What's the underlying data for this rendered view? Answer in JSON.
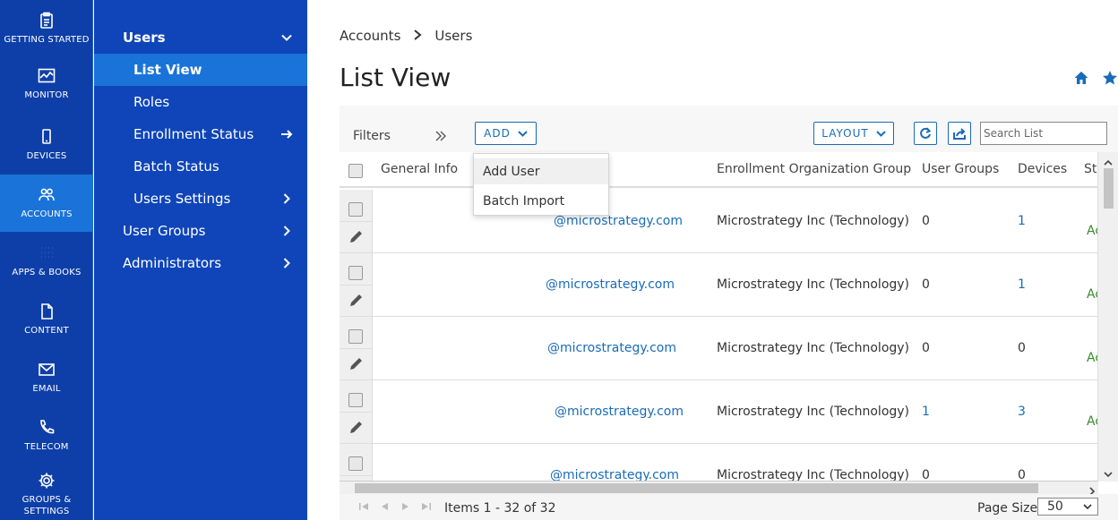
{
  "rail": {
    "items": [
      {
        "label": "GETTING STARTED",
        "icon": "clipboard-icon"
      },
      {
        "label": "MONITOR",
        "icon": "monitor-chart-icon"
      },
      {
        "label": "DEVICES",
        "icon": "phone-icon"
      },
      {
        "label": "ACCOUNTS",
        "icon": "users-icon"
      },
      {
        "label": "APPS & BOOKS",
        "icon": "grid-dots-icon"
      },
      {
        "label": "CONTENT",
        "icon": "document-icon"
      },
      {
        "label": "EMAIL",
        "icon": "envelope-icon"
      },
      {
        "label": "TELECOM",
        "icon": "telephone-icon"
      },
      {
        "label": "GROUPS & SETTINGS",
        "icon": "gear-icon"
      }
    ],
    "active": "ACCOUNTS"
  },
  "subnav": {
    "users": "Users",
    "list_view": "List View",
    "roles": "Roles",
    "enrollment_status": "Enrollment Status",
    "batch_status": "Batch Status",
    "users_settings": "Users Settings",
    "user_groups": "User Groups",
    "administrators": "Administrators"
  },
  "breadcrumb": {
    "first": "Accounts",
    "second": "Users"
  },
  "page": {
    "title": "List View"
  },
  "toolbar": {
    "filters": "Filters",
    "add": "ADD",
    "layout": "LAYOUT",
    "search_placeholder": "Search List"
  },
  "add_menu": {
    "add_user": "Add User",
    "batch_import": "Batch Import"
  },
  "table": {
    "columns": {
      "general_info": "General Info",
      "org_group": "Enrollment Organization Group",
      "user_groups": "User Groups",
      "devices": "Devices",
      "status": "St"
    },
    "rows": [
      {
        "email": "@microstrategy.com",
        "org": "Microstrategy Inc (Technology)",
        "user_groups": "0",
        "devices": "1",
        "status": "Ac"
      },
      {
        "email": "@microstrategy.com",
        "org": "Microstrategy Inc (Technology)",
        "user_groups": "0",
        "devices": "1",
        "status": "Ac"
      },
      {
        "email": "@microstrategy.com",
        "org": "Microstrategy Inc (Technology)",
        "user_groups": "0",
        "devices": "0",
        "status": "Ac"
      },
      {
        "email": "@microstrategy.com",
        "org": "Microstrategy Inc (Technology)",
        "user_groups": "1",
        "devices": "3",
        "status": "Ac"
      },
      {
        "email": "@microstrategy.com",
        "org": "Microstrategy Inc (Technology)",
        "user_groups": "0",
        "devices": "0",
        "status": ""
      }
    ]
  },
  "pager": {
    "items": "Items 1 - 32 of 32",
    "page_size_label": "Page Size:",
    "page_size": "50"
  },
  "colors": {
    "rail_bg": "#0e3fa8",
    "subnav_bg": "#0f45b8",
    "active": "#1a73d9",
    "link": "#1a6bb8",
    "status_green": "#3a8a2e"
  }
}
